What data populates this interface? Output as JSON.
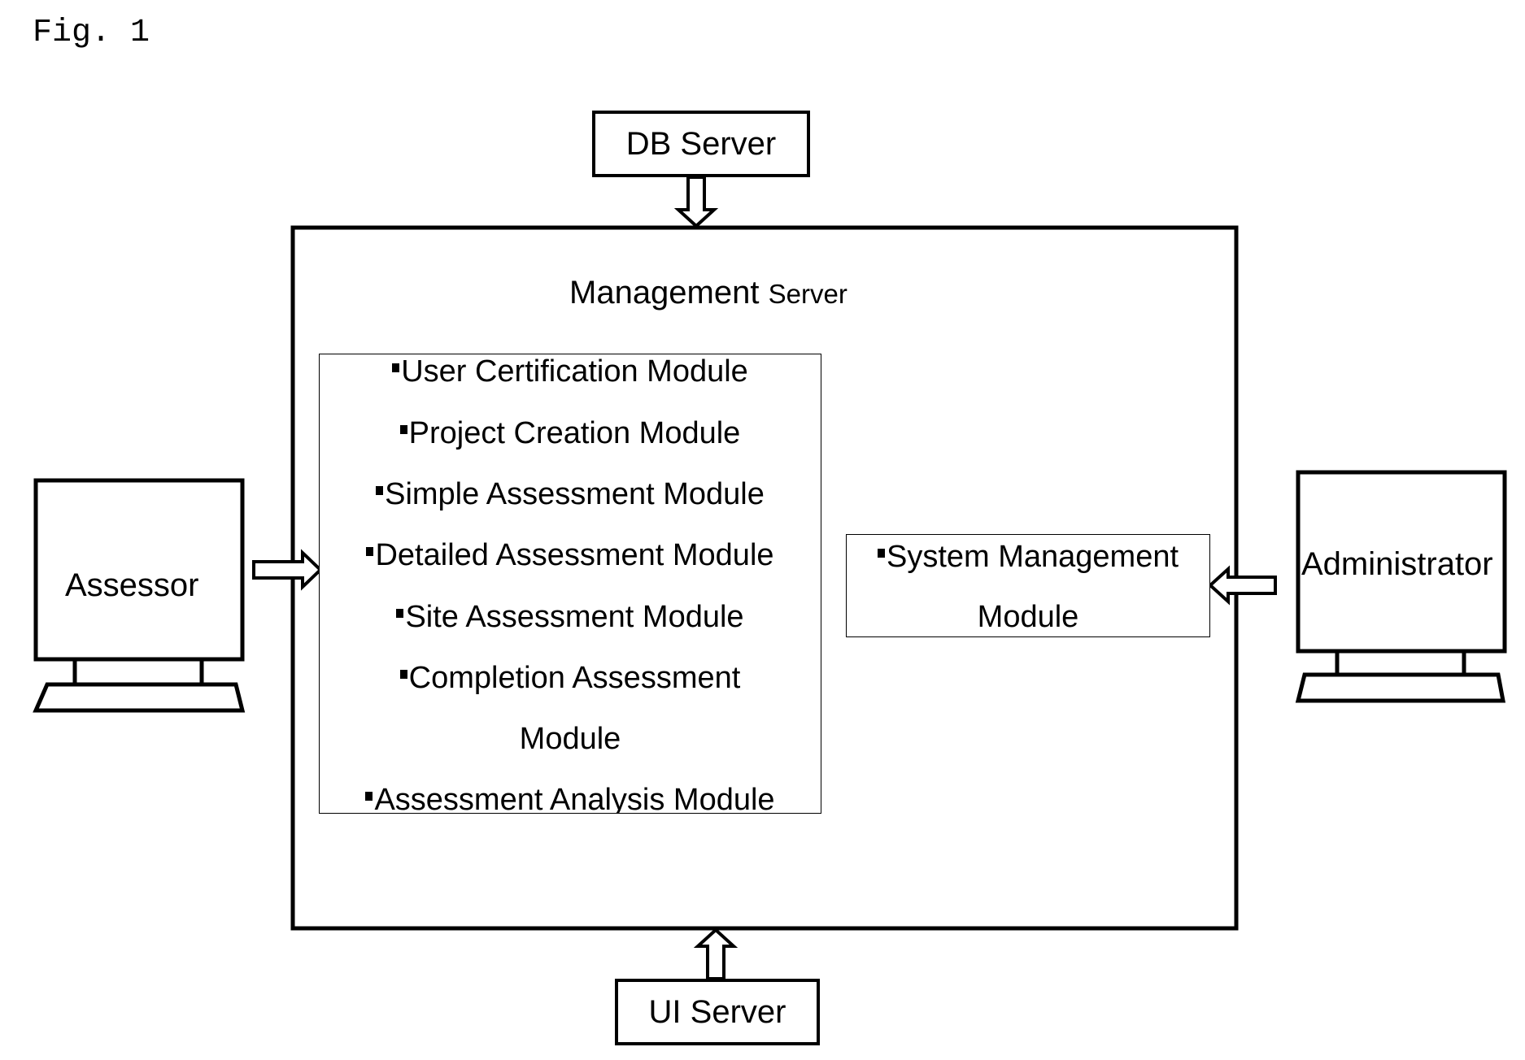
{
  "figure_label": "Fig. 1",
  "db_server": "DB Server",
  "ui_server": "UI Server",
  "management_server": {
    "title_main": "Management",
    "title_suffix": "Server",
    "modules": [
      "User Certification Module",
      "Project Creation Module",
      "Simple Assessment Module",
      "Detailed Assessment Module",
      "Site Assessment Module",
      "Completion Assessment",
      "Module",
      "Assessment Analysis Module"
    ],
    "system_module": [
      "System Management",
      "Module"
    ]
  },
  "assessor": "Assessor",
  "administrator": "Administrator"
}
